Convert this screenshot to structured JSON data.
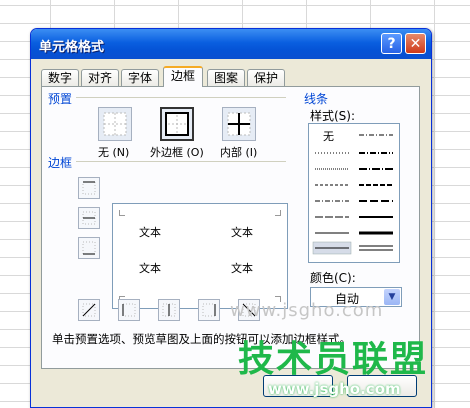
{
  "dialog": {
    "title": "单元格格式",
    "help_glyph": "?",
    "close_glyph": "✕"
  },
  "tabs": [
    {
      "label": "数字"
    },
    {
      "label": "对齐"
    },
    {
      "label": "字体"
    },
    {
      "label": "边框",
      "active": true
    },
    {
      "label": "图案"
    },
    {
      "label": "保护"
    }
  ],
  "presets": {
    "section_label": "预置",
    "items": [
      {
        "label": "无 (N)"
      },
      {
        "label": "外边框 (O)"
      },
      {
        "label": "内部 (I)"
      }
    ]
  },
  "border": {
    "section_label": "边框",
    "preview_texts": [
      "文本",
      "文本",
      "文本",
      "文本"
    ]
  },
  "line": {
    "section_label": "线条",
    "style_label": "样式(S):",
    "none_label": "无",
    "color_label": "颜色(C):",
    "color_value": "自动"
  },
  "hint": "单击预置选项、预览草图及上面的按钮可以添加边框样式。",
  "watermark": {
    "overlay_text": "上面的按钮可以添加边框样式",
    "brand": "技术员联盟",
    "url": "www.jsgho.com",
    "faint": "www.jsgho.com"
  },
  "colors": {
    "titlebar": "#0553d6",
    "accent_blue": "#0046d5",
    "watermark_green": "#1fb84a"
  }
}
